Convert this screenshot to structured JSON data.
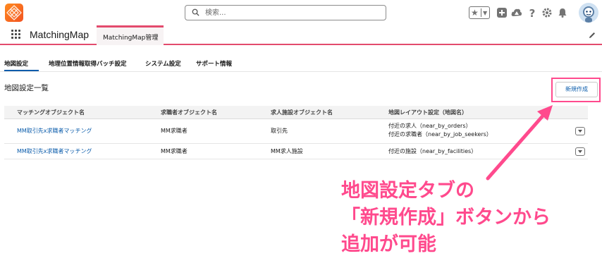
{
  "header": {
    "search_placeholder": "検索...",
    "icons": [
      "app-logo",
      "search-icon",
      "favorites-star-icon",
      "dropdown-icon",
      "add-icon",
      "trailhead-icon",
      "help-icon",
      "setup-gear-icon",
      "notifications-bell-icon",
      "avatar"
    ]
  },
  "appbar": {
    "app_name": "MatchingMap",
    "tab_label": "MatchingMap管理"
  },
  "subtabs": {
    "items": [
      "地図設定",
      "地理位置情報取得バッチ設定",
      "システム設定",
      "サポート情報"
    ],
    "active": "地図設定"
  },
  "list": {
    "title": "地図設定一覧",
    "new_button": "新規作成"
  },
  "table": {
    "columns": [
      "マッチングオブジェクト名",
      "求職者オブジェクト名",
      "求人施設オブジェクト名",
      "地図レイアウト設定（地図名）"
    ],
    "rows": [
      {
        "matching": "MM取引先x求職者マッチング",
        "seeker": "MM求職者",
        "facility": "取引先",
        "layout": [
          "付近の求人（near_by_orders）",
          "付近の求職者（near_by_job_seekers）"
        ]
      },
      {
        "matching": "MM取引先x求職者マッチング",
        "seeker": "MM求職者",
        "facility": "MM求人施設",
        "layout": [
          "付近の施設（near_by_facilities）"
        ]
      }
    ]
  },
  "annotation": {
    "lines": [
      "地図設定タブの",
      "「新規作成」ボタンから",
      "追加が可能"
    ],
    "color": "#ff4a8d"
  },
  "colors": {
    "accent": "#e34b6d",
    "link": "#0b5cab",
    "highlight": "#ff4a8d"
  }
}
